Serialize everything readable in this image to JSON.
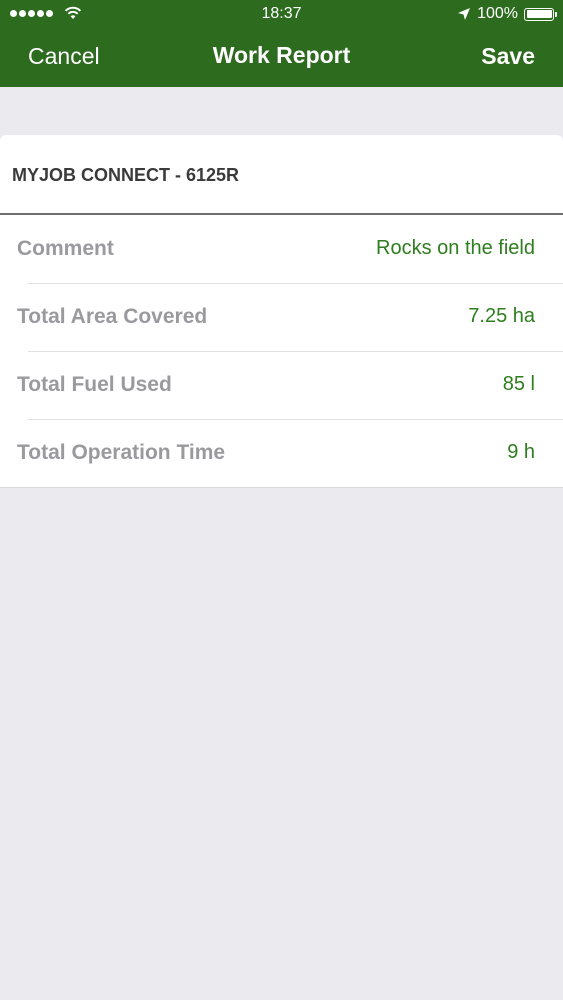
{
  "status_bar": {
    "time": "18:37",
    "battery_text": "100%",
    "signal_icon": "signal-dots-icon",
    "wifi_icon": "wifi-icon",
    "location_icon": "location-arrow-icon",
    "battery_icon": "battery-icon"
  },
  "nav": {
    "cancel_label": "Cancel",
    "title": "Work Report",
    "save_label": "Save"
  },
  "card": {
    "title": "MYJOB CONNECT - 6125R",
    "rows": [
      {
        "label": "Comment",
        "value": "Rocks on the field"
      },
      {
        "label": "Total Area Covered",
        "value": "7.25 ha"
      },
      {
        "label": "Total Fuel Used",
        "value": "85 l"
      },
      {
        "label": "Total Operation Time",
        "value": "9 h"
      }
    ]
  },
  "colors": {
    "brand_green": "#2D6B1F",
    "value_green": "#2E7D1E",
    "background": "#EBEBEF"
  }
}
